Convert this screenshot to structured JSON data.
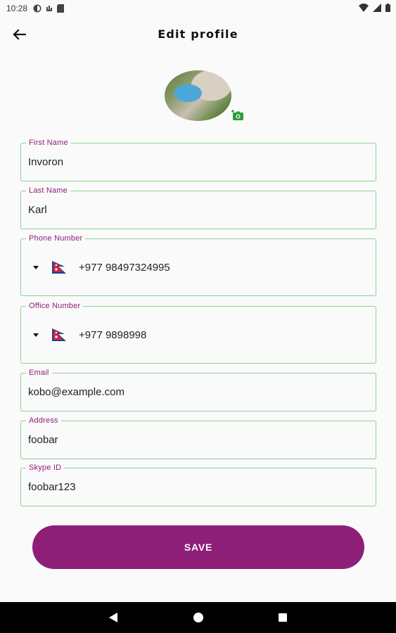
{
  "status_bar": {
    "time": "10:28",
    "left_icons": [
      "settings-icon",
      "sync-icon",
      "sim-icon"
    ],
    "right_icons": [
      "wifi-icon",
      "signal-icon",
      "battery-icon"
    ]
  },
  "app_bar": {
    "title": "Edit profile",
    "back_icon": "arrow-back-icon"
  },
  "profile": {
    "avatar_icon": "avatar-photo",
    "camera_icon": "camera-add-icon"
  },
  "form": {
    "first_name": {
      "label": "First Name",
      "value": "Invoron"
    },
    "last_name": {
      "label": "Last Name",
      "value": "Karl"
    },
    "phone": {
      "label": "Phone Number",
      "value": "+977 98497324995",
      "flag": "nepal-flag"
    },
    "office": {
      "label": "Office Number",
      "value": "+977 9898998",
      "flag": "nepal-flag"
    },
    "email": {
      "label": "Email",
      "value": "kobo@example.com"
    },
    "address": {
      "label": "Address",
      "value": "foobar"
    },
    "skype": {
      "label": "Skype ID",
      "value": "foobar123"
    }
  },
  "actions": {
    "save_label": "SAVE"
  },
  "colors": {
    "accent": "#8e1f78",
    "border": "#8ed08e",
    "camera": "#2e9e3a"
  },
  "nav_bar": {
    "icons": [
      "back-triangle-icon",
      "home-circle-icon",
      "recents-square-icon"
    ]
  }
}
